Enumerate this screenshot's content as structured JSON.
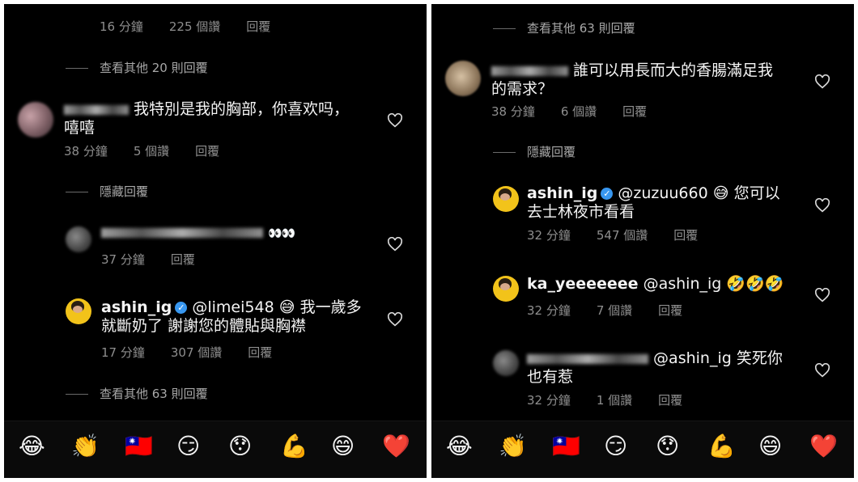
{
  "left": {
    "top_meta": {
      "time": "16 分鐘",
      "likes": "225 個讚",
      "reply": "回覆"
    },
    "view_more_1": "查看其他 20 則回覆",
    "comment_a": {
      "text_line1": "我特別是我的胸部，你喜欢吗，",
      "text_line2": "嘻嘻",
      "time": "38 分鐘",
      "likes": "5 個讚",
      "reply": "回覆"
    },
    "hide_replies": "隱藏回覆",
    "comment_b": {
      "eyes": "👀👀",
      "time": "37 分鐘",
      "reply": "回覆"
    },
    "comment_c": {
      "username": "ashin_ig",
      "mention": "@limei548",
      "emoji": "😅",
      "text_line1_tail": "我一歲多",
      "text_line2": "就斷奶了  謝謝您的體貼與胸襟",
      "time": "17 分鐘",
      "likes": "307 個讚",
      "reply": "回覆"
    },
    "view_more_2": "查看其他 63 則回覆"
  },
  "right": {
    "view_more": "查看其他 63 則回覆",
    "comment_a": {
      "text_line1": "誰可以用長而大的香腸滿足我",
      "text_line2": "的需求？",
      "time": "38 分鐘",
      "likes": "6 個讚",
      "reply": "回覆"
    },
    "hide_replies": "隱藏回覆",
    "comment_b": {
      "username": "ashin_ig",
      "mention": "@zuzuu660",
      "emoji": "😅",
      "text_line1_tail": "您可以",
      "text_line2": "去士林夜市看看",
      "time": "32 分鐘",
      "likes": "547 個讚",
      "reply": "回覆"
    },
    "comment_c": {
      "username": "ka_yeeeeeee",
      "mention": "@ashin_ig",
      "emoji": "🤣🤣🤣",
      "time": "32 分鐘",
      "likes": "7 個讚",
      "reply": "回覆"
    },
    "comment_d": {
      "mention": "@ashin_ig",
      "text_line1_tail": "笑死你",
      "text_line2": "也有惹",
      "time": "32 分鐘",
      "likes": "1 個讚",
      "reply": "回覆"
    }
  },
  "emoji_bar": [
    "😂",
    "👏",
    "🇹🇼",
    "😏",
    "😯",
    "💪",
    "😄",
    "❤️"
  ],
  "colors": {
    "background": "#000000",
    "meta_text": "#8e8e8e",
    "verified": "#3897f0",
    "heart_reaction": "#e0245e"
  }
}
